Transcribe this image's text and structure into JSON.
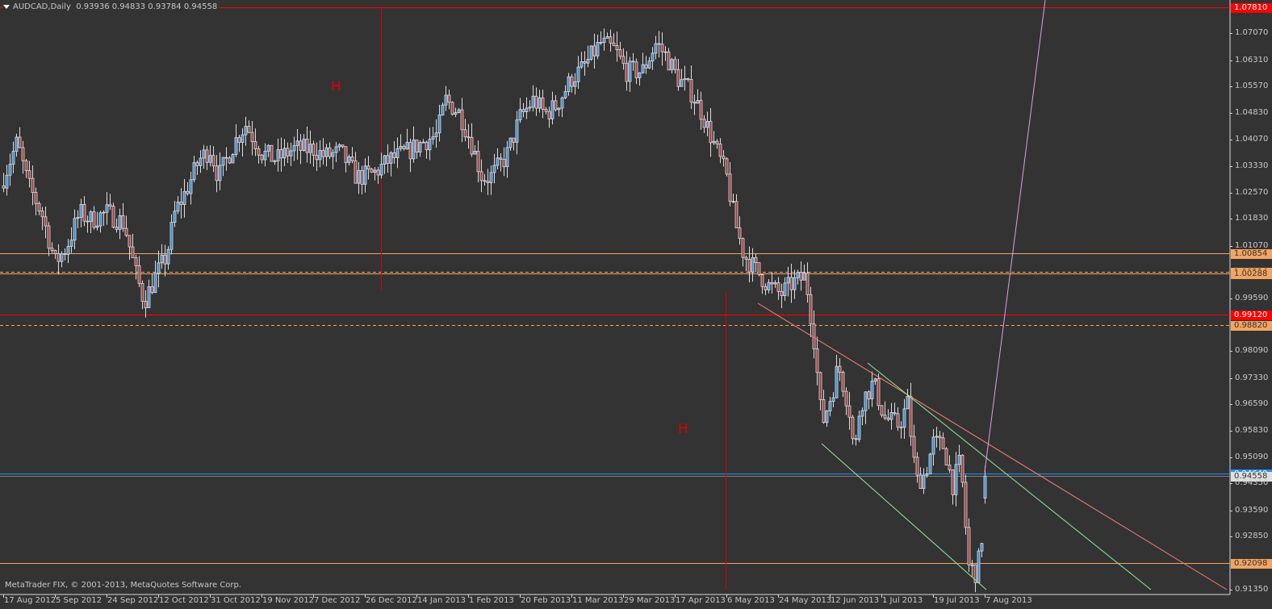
{
  "header": {
    "symbol": "AUDCAD,Daily",
    "ohlc": "0.93936 0.94833 0.93784 0.94558",
    "open": 0.93936,
    "high": 0.94833,
    "low": 0.93784,
    "close": 0.94558
  },
  "copyright": "MetaTrader FIX, © 2001-2013, MetaQuotes Software Corp.",
  "colors": {
    "background": "#333333",
    "bull_candle": "#3a8ed6",
    "bear_candle": "#a23c3c",
    "candle_outline": "#dcdcdc",
    "level_red": "#ff0000",
    "level_orange": "#f4a460",
    "trendline_salmon": "#fa8072",
    "trendline_green": "#90ee90",
    "line_violet": "#dda0dd",
    "bid_line": "#1e90ff"
  },
  "annotations": [
    "H",
    "H"
  ],
  "chart_data": {
    "type": "candlestick",
    "symbol": "AUDCAD",
    "timeframe": "Daily",
    "ylim": [
      0.9135,
      1.0781
    ],
    "grid": false,
    "y_ticks": [
      "1.07070",
      "1.06310",
      "1.05570",
      "1.04830",
      "1.04070",
      "1.03330",
      "1.02570",
      "1.01830",
      "1.01070",
      "0.99590",
      "0.98090",
      "0.97330",
      "0.96590",
      "0.95830",
      "0.95090",
      "0.94350",
      "0.93590",
      "0.92850",
      "0.91350"
    ],
    "x_ticks": [
      "17 Aug 2012",
      "5 Sep 2012",
      "24 Sep 2012",
      "12 Oct 2012",
      "31 Oct 2012",
      "19 Nov 2012",
      "7 Dec 2012",
      "26 Dec 2012",
      "14 Jan 2013",
      "1 Feb 2013",
      "20 Feb 2013",
      "11 Mar 2013",
      "29 Mar 2013",
      "17 Apr 2013",
      "6 May 2013",
      "24 May 2013",
      "12 Jun 2013",
      "1 Jul 2013",
      "19 Jul 2013",
      "7 Aug 2013"
    ],
    "levels": [
      {
        "label": "1.07810",
        "price": 1.0781,
        "color": "#ff0000",
        "style": "solid",
        "label_bg": "#ff0000",
        "label_fg": "#ffffff"
      },
      {
        "label": "1.00854",
        "price": 1.00854,
        "color": "#f4a460",
        "style": "solid",
        "label_bg": "#f4a460",
        "label_fg": "#333333"
      },
      {
        "label": "1.00334",
        "price": 1.00334,
        "color": "#f4a460",
        "style": "dashed",
        "label_bg": "#f4a460",
        "label_fg": "#333333"
      },
      {
        "label": "1.00288",
        "price": 1.00288,
        "color": "#f4a460",
        "style": "solid",
        "label_bg": "#f4a460",
        "label_fg": "#333333"
      },
      {
        "label": "0.99120",
        "price": 0.9912,
        "color": "#ff0000",
        "style": "solid",
        "label_bg": "#ff0000",
        "label_fg": "#ffffff"
      },
      {
        "label": "0.98820",
        "price": 0.9882,
        "color": "#f4a460",
        "style": "dashed",
        "label_bg": "#f4a460",
        "label_fg": "#333333"
      },
      {
        "label": "0.94640",
        "price": 0.9464,
        "color": "#1e90ff",
        "style": "solid",
        "label_bg": "#1e90ff",
        "label_fg": "#ffffff"
      },
      {
        "label": "0.94558",
        "price": 0.94558,
        "color": "#808080",
        "style": "solid",
        "label_bg": "#e0e0e0",
        "label_fg": "#333333"
      },
      {
        "label": "0.92098",
        "price": 0.92098,
        "color": "#f4a460",
        "style": "solid",
        "label_bg": "#f4a460",
        "label_fg": "#333333"
      }
    ],
    "close_path": [
      [
        "2012-08-17",
        1.03
      ],
      [
        "2012-08-22",
        1.04
      ],
      [
        "2012-08-26",
        1.028
      ],
      [
        "2012-08-31",
        1.02
      ],
      [
        "2012-09-05",
        1.006
      ],
      [
        "2012-09-09",
        1.01
      ],
      [
        "2012-09-14",
        1.02
      ],
      [
        "2012-09-18",
        1.018
      ],
      [
        "2012-09-24",
        1.02
      ],
      [
        "2012-09-30",
        1.017
      ],
      [
        "2012-10-04",
        1.003
      ],
      [
        "2012-10-07",
        0.995
      ],
      [
        "2012-10-11",
        1.002
      ],
      [
        "2012-10-15",
        1.008
      ],
      [
        "2012-10-18",
        1.02
      ],
      [
        "2012-10-22",
        1.026
      ],
      [
        "2012-10-27",
        1.035
      ],
      [
        "2012-10-31",
        1.038
      ],
      [
        "2012-11-03",
        1.03
      ],
      [
        "2012-11-09",
        1.04
      ],
      [
        "2012-11-13",
        1.045
      ],
      [
        "2012-11-19",
        1.037
      ],
      [
        "2012-11-24",
        1.035
      ],
      [
        "2012-11-30",
        1.038
      ],
      [
        "2012-12-07",
        1.038
      ],
      [
        "2012-12-11",
        1.036
      ],
      [
        "2012-12-17",
        1.037
      ],
      [
        "2012-12-23",
        1.03
      ],
      [
        "2012-12-29",
        1.031
      ],
      [
        "2013-01-04",
        1.035
      ],
      [
        "2013-01-10",
        1.037
      ],
      [
        "2013-01-16",
        1.04
      ],
      [
        "2013-01-21",
        1.042
      ],
      [
        "2013-01-24",
        1.052
      ],
      [
        "2013-01-29",
        1.048
      ],
      [
        "2013-02-02",
        1.04
      ],
      [
        "2013-02-06",
        1.03
      ],
      [
        "2013-02-09",
        1.03
      ],
      [
        "2013-02-15",
        1.036
      ],
      [
        "2013-02-20",
        1.047
      ],
      [
        "2013-02-25",
        1.052
      ],
      [
        "2013-03-01",
        1.048
      ],
      [
        "2013-03-05",
        1.05
      ],
      [
        "2013-03-11",
        1.058
      ],
      [
        "2013-03-15",
        1.061
      ],
      [
        "2013-03-21",
        1.068
      ],
      [
        "2013-03-26",
        1.066
      ],
      [
        "2013-03-30",
        1.06
      ],
      [
        "2013-04-05",
        1.06
      ],
      [
        "2013-04-10",
        1.068
      ],
      [
        "2013-04-14",
        1.064
      ],
      [
        "2013-04-18",
        1.058
      ],
      [
        "2013-04-23",
        1.054
      ],
      [
        "2013-04-27",
        1.048
      ],
      [
        "2013-05-01",
        1.04
      ],
      [
        "2013-05-06",
        1.03
      ],
      [
        "2013-05-09",
        1.017
      ],
      [
        "2013-05-12",
        1.008
      ],
      [
        "2013-05-16",
        1.004
      ],
      [
        "2013-05-21",
        0.999
      ],
      [
        "2013-05-25",
        0.997
      ],
      [
        "2013-05-29",
        1.0
      ],
      [
        "2013-06-03",
        1.002
      ],
      [
        "2013-06-06",
        0.985
      ],
      [
        "2013-06-09",
        0.96
      ],
      [
        "2013-06-13",
        0.97
      ],
      [
        "2013-06-15",
        0.977
      ],
      [
        "2013-06-19",
        0.965
      ],
      [
        "2013-06-21",
        0.951
      ],
      [
        "2013-06-23",
        0.966
      ],
      [
        "2013-06-28",
        0.972
      ],
      [
        "2013-07-02",
        0.962
      ],
      [
        "2013-07-07",
        0.96
      ],
      [
        "2013-07-10",
        0.966
      ],
      [
        "2013-07-13",
        0.944
      ],
      [
        "2013-07-16",
        0.946
      ],
      [
        "2013-07-19",
        0.955
      ],
      [
        "2013-07-23",
        0.954
      ],
      [
        "2013-07-26",
        0.943
      ],
      [
        "2013-07-29",
        0.95
      ],
      [
        "2013-08-01",
        0.92
      ],
      [
        "2013-08-04",
        0.918
      ],
      [
        "2013-08-07",
        0.935
      ],
      [
        "2013-08-10",
        0.94558
      ]
    ]
  }
}
